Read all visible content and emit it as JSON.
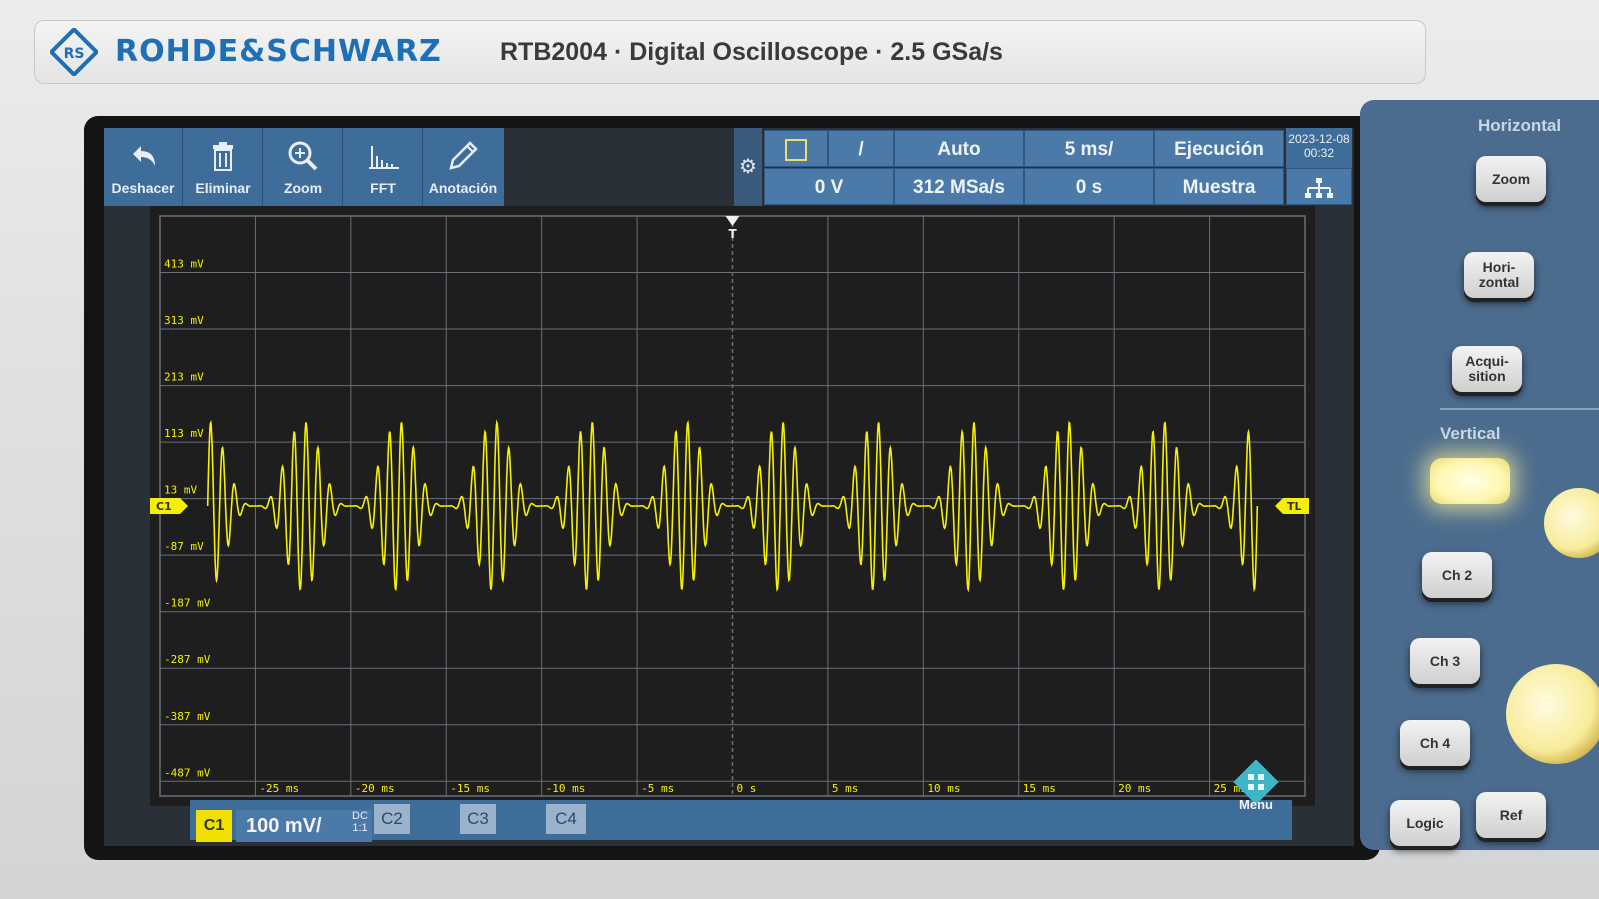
{
  "device": {
    "brand": "ROHDE&SCHWARZ",
    "model_line": "RTB2004 · Digital Oscilloscope · 2.5 GSa/s"
  },
  "toolbar": {
    "items": [
      {
        "label": "Deshacer",
        "icon": "undo-icon"
      },
      {
        "label": "Eliminar",
        "icon": "trash-icon"
      },
      {
        "label": "Zoom",
        "icon": "zoom-icon"
      },
      {
        "label": "FFT",
        "icon": "fft-icon"
      },
      {
        "label": "Anotación",
        "icon": "pencil-icon"
      }
    ],
    "settings_icon": "gear-icon"
  },
  "status": {
    "trigger_source": "",
    "trigger_slope": "/",
    "trigger_level": "0 V",
    "trigger_mode": "Auto",
    "sample_rate": "312 MSa/s",
    "timebase": "5 ms/",
    "position": "0 s",
    "run_state": "Ejecución",
    "acq_mode": "Muestra",
    "date": "2023-12-08",
    "time": "00:32",
    "network_icon": "network-icon"
  },
  "channel_bar": {
    "c1_label": "C1",
    "c1_scale": "100 mV/",
    "c1_coupling": "DC",
    "c1_probe": "1:1",
    "tabs": [
      "C2",
      "C3",
      "C4"
    ],
    "menu_label": "Menu"
  },
  "markers": {
    "channel": "C1",
    "trigger_level": "TL",
    "trigger_pos": "T"
  },
  "y_ticks": [
    "413 mV",
    "313 mV",
    "213 mV",
    "113 mV",
    "13 mV",
    "-87 mV",
    "-187 mV",
    "-287 mV",
    "-387 mV",
    "-487 mV"
  ],
  "x_ticks": [
    "-25 ms",
    "-20 ms",
    "-15 ms",
    "-10 ms",
    "-5 ms",
    "0 s",
    "5 ms",
    "10 ms",
    "15 ms",
    "20 ms",
    "25 ms"
  ],
  "side_panel": {
    "horizontal_title": "Horizontal",
    "vertical_title": "Vertical",
    "buttons": [
      "Zoom",
      "Hori- zontal",
      "Acqui- sition",
      "Ch 2",
      "Ch 3",
      "Ch 4",
      "Logic",
      "Ref"
    ]
  },
  "colors": {
    "trace": "#f5f000",
    "ui_blue": "#3f6d99",
    "grid": "#6a6f78"
  },
  "chart_data": {
    "type": "line",
    "title": "",
    "xlabel": "",
    "ylabel": "",
    "x_range_ms": [
      -30,
      30
    ],
    "y_range_mV": [
      -513,
      513
    ],
    "series": [
      {
        "name": "",
        "description_values": {
          "envelope_period_ms": 5,
          "peak_amplitude_mV": 150,
          "offset_mV": 0
        }
      }
    ],
    "grid": true
  }
}
